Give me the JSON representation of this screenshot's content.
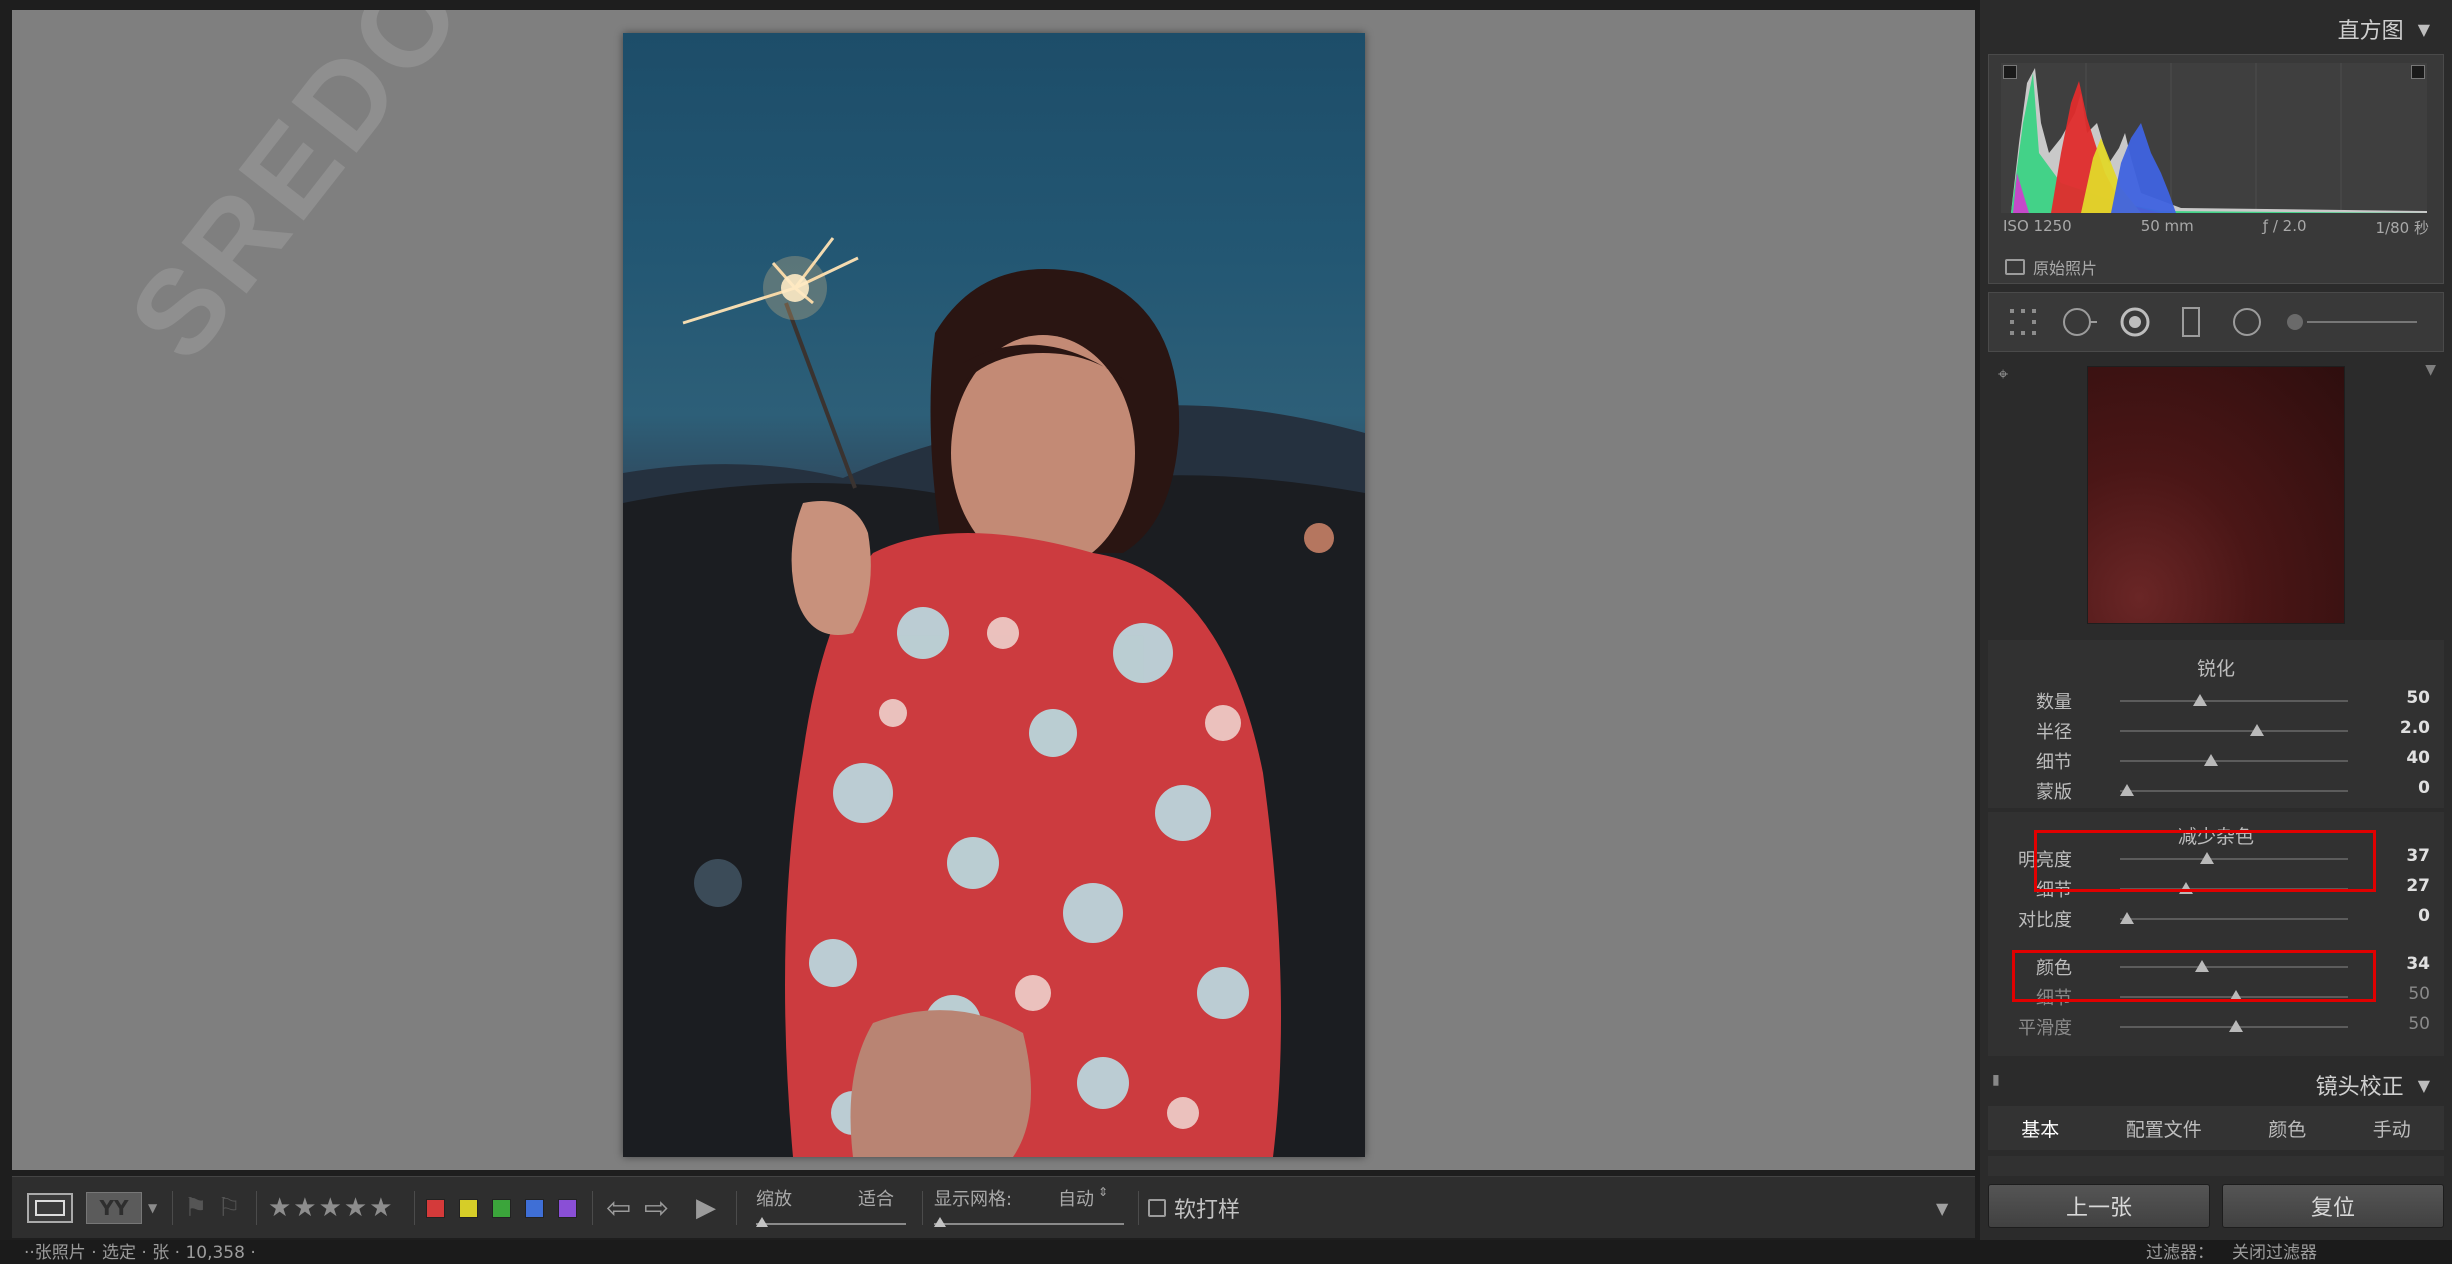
{
  "photo": {
    "watermark": "SREDOEDE"
  },
  "histogram": {
    "title": "直方图",
    "iso": "ISO 1250",
    "focal": "50 mm",
    "aperture": "ƒ / 2.0",
    "shutter": "1/80 秒",
    "original_photo": "原始照片"
  },
  "sharpening": {
    "title": "锐化",
    "sliders": [
      {
        "label": "数量",
        "value": "50",
        "pos": 0.35
      },
      {
        "label": "半径",
        "value": "2.0",
        "pos": 0.6
      },
      {
        "label": "细节",
        "value": "40",
        "pos": 0.4
      },
      {
        "label": "蒙版",
        "value": "0",
        "pos": 0.03
      }
    ]
  },
  "noise_reduction": {
    "title": "减少杂色",
    "sliders": [
      {
        "label": "明亮度",
        "value": "37",
        "pos": 0.38
      },
      {
        "label": "细节",
        "value": "27",
        "pos": 0.29
      },
      {
        "label": "对比度",
        "value": "0",
        "pos": 0.03
      },
      {
        "label": "颜色",
        "value": "34",
        "pos": 0.36
      },
      {
        "label": "细节",
        "value": "50",
        "pos": 0.51
      },
      {
        "label": "平滑度",
        "value": "50",
        "pos": 0.51
      }
    ]
  },
  "lens_correction": {
    "title": "镜头校正",
    "tabs": [
      "基本",
      "配置文件",
      "颜色",
      "手动"
    ],
    "active_tab": "基本"
  },
  "buttons": {
    "previous": "上一张",
    "reset": "复位"
  },
  "toolbar": {
    "zoom_label": "缩放",
    "zoom_value": "适合",
    "grid_label": "显示网格:",
    "grid_value": "自动",
    "soft_proof": "软打样",
    "stars": "★★★★★",
    "color_labels": [
      "#d43a3a",
      "#d6cd28",
      "#3ba53b",
      "#3f6fd6",
      "#8a4fd6"
    ]
  },
  "status_bar": {
    "left": "··张照片 · 选定 · 张 · 10,358 ·",
    "filter": "过滤器：",
    "filter_value": "关闭过滤器"
  }
}
